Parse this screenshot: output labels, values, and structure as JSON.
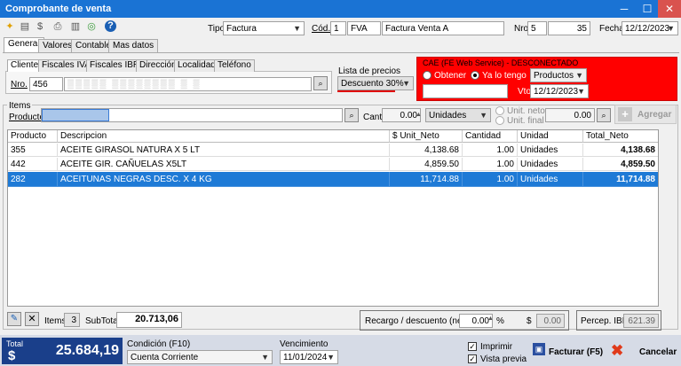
{
  "window": {
    "title": "Comprobante de venta"
  },
  "header": {
    "tipo_label": "Tipo",
    "tipo_value": "Factura",
    "cod_label": "Cód.",
    "cod_value": "1",
    "cod_abbr": "FVA",
    "cod_desc": "Factura Venta A",
    "nro_label": "Nro",
    "nro_pv": "5",
    "nro_num": "35",
    "fecha_label": "Fecha",
    "fecha_value": "12/12/2023"
  },
  "tabs": [
    "General",
    "Valores",
    "Contable",
    "Mas datos"
  ],
  "subtabs": [
    "Cliente",
    "Fiscales IVA",
    "Fiscales IBR",
    "Dirección",
    "Localidad",
    "Teléfono"
  ],
  "cliente": {
    "nro_label": "Nro.",
    "nro_value": "456"
  },
  "lista_precios": {
    "label": "Lista de precios",
    "value": "Descuento 30%"
  },
  "cae": {
    "header": "CAE (FE Web Service) - DESCONECTADO",
    "obtener_label": "Obtener",
    "yalotengo_label": "Ya lo tengo",
    "tipo_value": "Productos",
    "vto_label": "Vto",
    "vto_value": "12/12/2023"
  },
  "items": {
    "group_label": "Items",
    "producto_label": "Producto",
    "cant_label": "Cant.",
    "cant_value": "0.00",
    "unidad_value": "Unidades",
    "unit_neto_label": "Unit. neto",
    "unit_final_label": "Unit. final",
    "precio_value": "0.00",
    "agregar_label": "Agregar"
  },
  "grid": {
    "columns": [
      "Producto",
      "Descripcion",
      "$ Unit_Neto",
      "Cantidad",
      "Unidad",
      "Total_Neto"
    ],
    "rows": [
      {
        "producto": "355",
        "descripcion": "ACEITE GIRASOL NATURA X 5 LT",
        "unit_neto": "4,138.68",
        "cantidad": "1.00",
        "unidad": "Unidades",
        "total": "4,138.68"
      },
      {
        "producto": "442",
        "descripcion": "ACEITE GIR. CAÑUELAS X5LT",
        "unit_neto": "4,859.50",
        "cantidad": "1.00",
        "unidad": "Unidades",
        "total": "4,859.50"
      },
      {
        "producto": "282",
        "descripcion": "ACEITUNAS NEGRAS DESC. X 4 KG",
        "unit_neto": "11,714.88",
        "cantidad": "1.00",
        "unidad": "Unidades",
        "total": "11,714.88"
      }
    ]
  },
  "footer_grid": {
    "items_label": "Items",
    "items_value": "3",
    "subtotal_label": "SubTotal",
    "subtotal_value": "20.713,06",
    "recargo_label": "Recargo / descuento (neg.)",
    "recargo_value": "0.00",
    "percent_sign": "%",
    "dollar_sign": "$",
    "recargo_amount": "0.00",
    "percep_label": "Percep. IBR",
    "percep_value": "621.39"
  },
  "bottom": {
    "total_label": "Total",
    "currency": "$",
    "total_value": "25.684,19",
    "condicion_label": "Condición (F10)",
    "condicion_value": "Cuenta Corriente",
    "vencimiento_label": "Vencimiento",
    "vencimiento_value": "11/01/2024",
    "imprimir_label": "Imprimir",
    "vista_previa_label": "Vista previa",
    "facturar_label": "Facturar (F5)",
    "cancelar_label": "Cancelar"
  },
  "colors": {
    "title_bar": "#1a73d4",
    "cae_panel": "#ff0000",
    "selected_row": "#1e7ad6",
    "total_box": "#1a3f8a"
  }
}
